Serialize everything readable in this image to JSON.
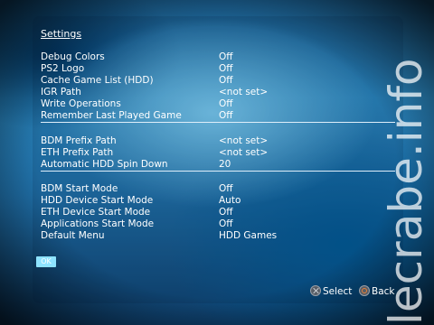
{
  "title": "Settings",
  "groups": [
    {
      "rows": [
        {
          "label": "Debug Colors",
          "value": "Off"
        },
        {
          "label": "PS2 Logo",
          "value": "Off"
        },
        {
          "label": "Cache Game List (HDD)",
          "value": "Off"
        },
        {
          "label": "IGR Path",
          "value": "<not set>"
        },
        {
          "label": "Write Operations",
          "value": "Off"
        },
        {
          "label": "Remember Last Played Game",
          "value": "Off"
        }
      ]
    },
    {
      "rows": [
        {
          "label": "BDM Prefix Path",
          "value": "<not set>"
        },
        {
          "label": "ETH Prefix Path",
          "value": "<not set>"
        },
        {
          "label": "Automatic HDD Spin Down",
          "value": "20"
        }
      ]
    },
    {
      "rows": [
        {
          "label": "BDM Start Mode",
          "value": "Off"
        },
        {
          "label": "HDD Device Start Mode",
          "value": "Auto"
        },
        {
          "label": "ETH Device Start Mode",
          "value": "Off"
        },
        {
          "label": "Applications Start Mode",
          "value": "Off"
        },
        {
          "label": "Default Menu",
          "value": "HDD Games"
        }
      ]
    }
  ],
  "ok_label": "OK",
  "footer": {
    "select_icon": "cross-button-icon",
    "select_label": "Select",
    "back_icon": "circle-button-icon",
    "back_label": "Back"
  },
  "watermark": "lecrabe.info"
}
